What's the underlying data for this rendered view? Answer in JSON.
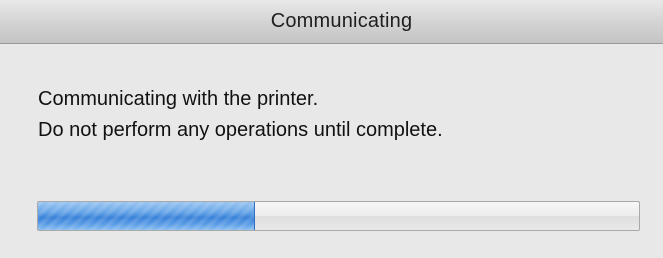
{
  "window": {
    "title": "Communicating"
  },
  "message": {
    "line1": "Communicating with the printer.",
    "line2": "Do not perform any operations until complete."
  },
  "progress": {
    "value_percent": 36,
    "fill_color": "#3b83d9",
    "track_color": "#ececec"
  }
}
